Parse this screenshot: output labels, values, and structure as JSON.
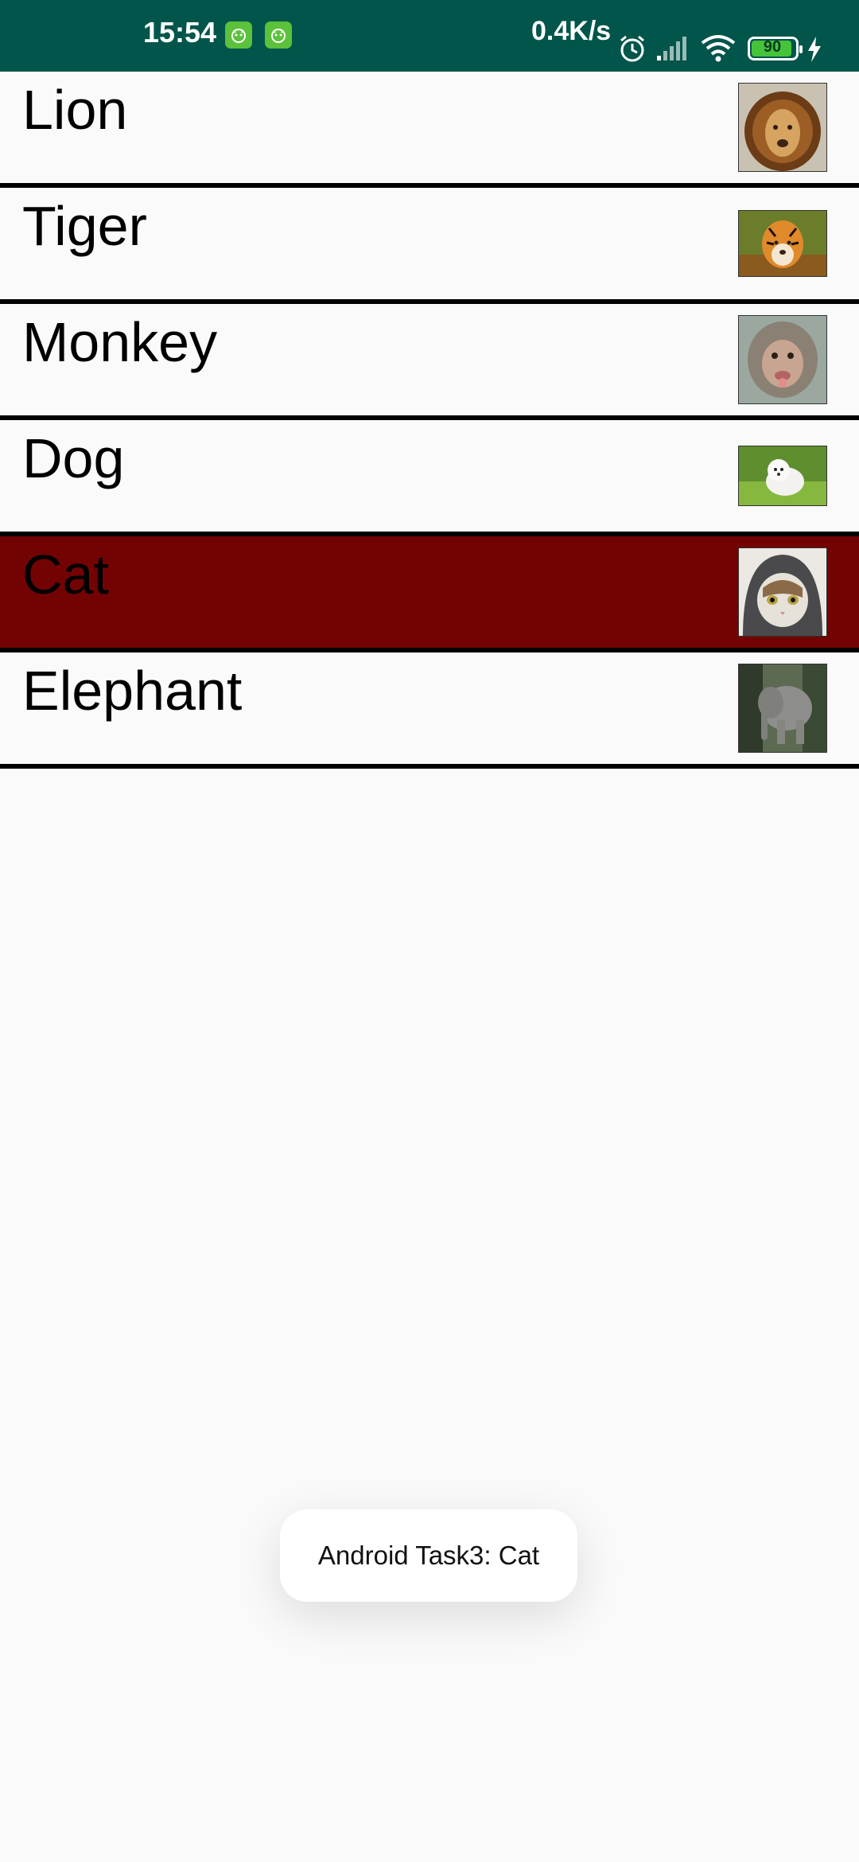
{
  "status_bar": {
    "time": "15:54",
    "net_speed": "0.4K/s",
    "battery": "90",
    "icons": [
      "app-notification-icon",
      "app-notification-icon",
      "alarm-icon",
      "signal-icon",
      "wifi-icon",
      "battery-icon",
      "charging-icon"
    ]
  },
  "list": {
    "items": [
      {
        "label": "Lion",
        "image": "lion-photo",
        "selected": false
      },
      {
        "label": "Tiger",
        "image": "tiger-photo",
        "selected": false
      },
      {
        "label": "Monkey",
        "image": "monkey-photo",
        "selected": false
      },
      {
        "label": "Dog",
        "image": "dog-photo",
        "selected": false
      },
      {
        "label": "Cat",
        "image": "cat-photo",
        "selected": true
      },
      {
        "label": "Elephant",
        "image": "elephant-photo",
        "selected": false
      }
    ]
  },
  "toast": {
    "message": "Android Task3: Cat"
  },
  "colors": {
    "status_bar": "#01554a",
    "selected_row": "#730303",
    "divider": "#000000",
    "background": "#fafafa"
  }
}
